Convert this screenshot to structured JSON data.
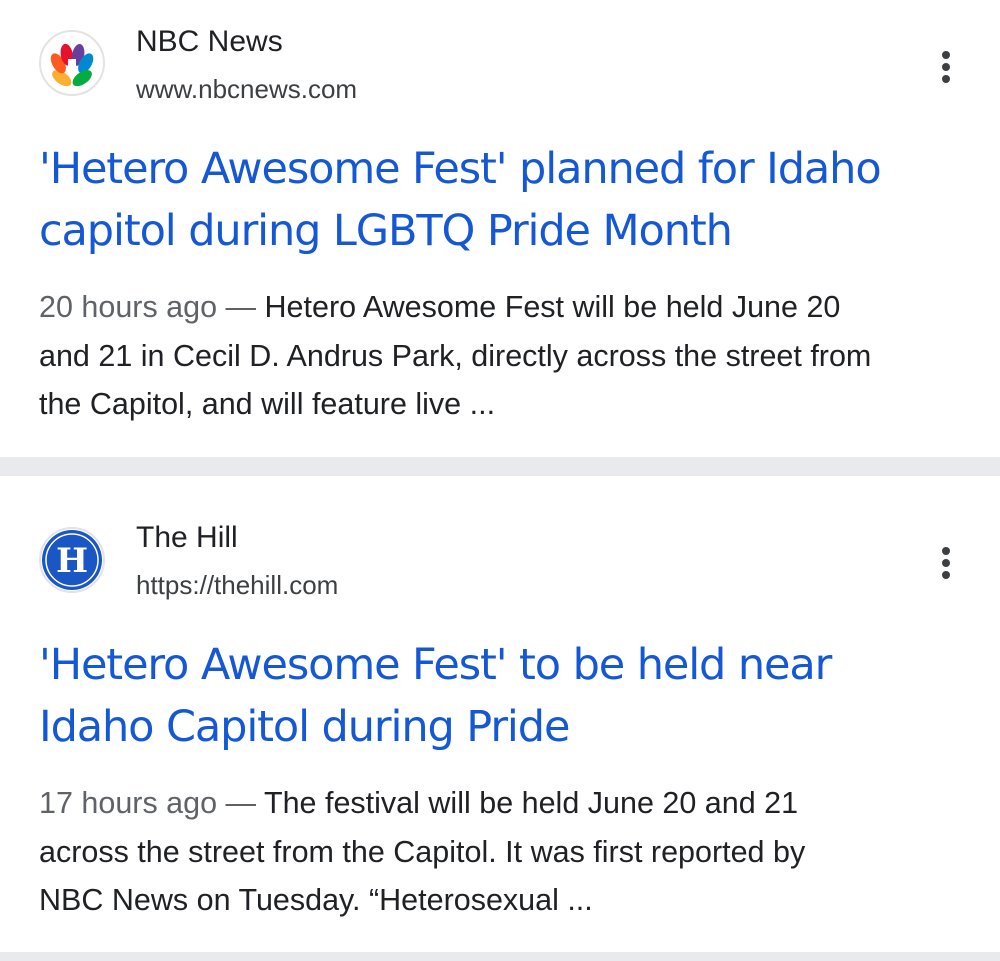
{
  "results": [
    {
      "source_name": "NBC News",
      "source_url": "www.nbcnews.com",
      "favicon": "nbc-peacock-icon",
      "title_lines": [
        "'Hetero Awesome Fest' planned for Idaho",
        "capitol during LGBTQ Pride Month"
      ],
      "age": "20 hours ago",
      "separator": " — ",
      "snippet_lines": [
        "Hetero Awesome Fest will be held June 20",
        "and 21 in Cecil D. Andrus Park, directly across the street from",
        "the Capitol, and will feature live ..."
      ],
      "more_icon": "more-vert-icon"
    },
    {
      "source_name": "The Hill",
      "source_url": "https://thehill.com",
      "favicon": "the-hill-logo-icon",
      "favicon_letter": "H",
      "title_lines": [
        "'Hetero Awesome Fest' to be held near",
        "Idaho Capitol during Pride"
      ],
      "age": "17 hours ago",
      "separator": " — ",
      "snippet_lines": [
        "The festival will be held June 20 and 21",
        "across the street from the Capitol. It was first reported by",
        "NBC News on Tuesday. “Heterosexual ..."
      ],
      "more_icon": "more-vert-icon"
    }
  ],
  "colors": {
    "title_link": "#1558d6",
    "body_text": "#202124",
    "meta_text": "#5f6368",
    "divider": "#e8eaed",
    "hill_blue": "#1a56c4"
  }
}
